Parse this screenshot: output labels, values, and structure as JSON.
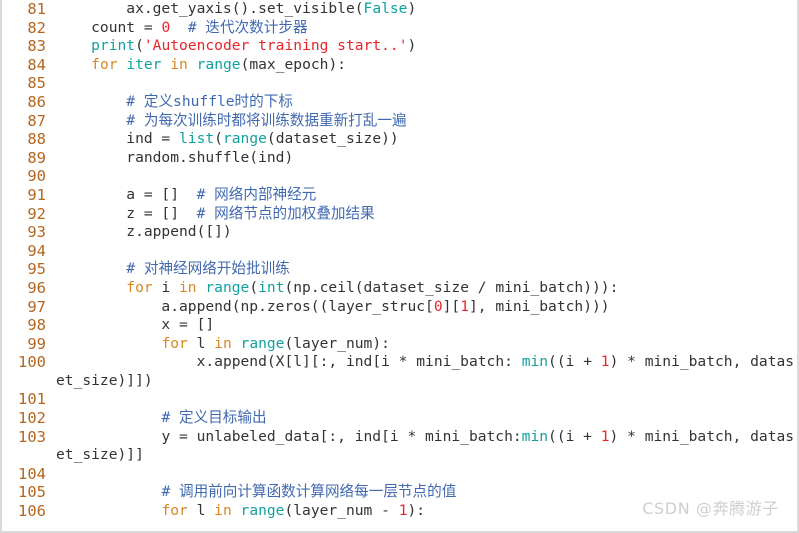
{
  "editor": {
    "language": "python",
    "first_line_number": 81,
    "last_line_number": 106,
    "colors": {
      "background": "#ffffff",
      "line_number": "#b4661e",
      "plain_text": "#333333",
      "keyword": "#d98723",
      "builtin": "#11a0a0",
      "string": "#e8242a",
      "number": "#e8242a",
      "comment": "#4169b0",
      "border": "#d9d9d9",
      "watermark": "#cfcfcf"
    }
  },
  "watermark": {
    "text": "CSDN @奔腾游子"
  },
  "lines": [
    {
      "number": "81",
      "wrapped": false,
      "tokens": [
        {
          "text": "        ax.get_yaxis().set_visible(",
          "type": "plain"
        },
        {
          "text": "False",
          "type": "builtin"
        },
        {
          "text": ")",
          "type": "plain"
        }
      ]
    },
    {
      "number": "82",
      "wrapped": false,
      "tokens": [
        {
          "text": "    count = ",
          "type": "plain"
        },
        {
          "text": "0",
          "type": "number"
        },
        {
          "text": "  ",
          "type": "plain"
        },
        {
          "text": "# 迭代次数计步器",
          "type": "comment"
        }
      ]
    },
    {
      "number": "83",
      "wrapped": false,
      "tokens": [
        {
          "text": "    ",
          "type": "plain"
        },
        {
          "text": "print",
          "type": "builtin"
        },
        {
          "text": "(",
          "type": "plain"
        },
        {
          "text": "'Autoencoder training start..'",
          "type": "string"
        },
        {
          "text": ")",
          "type": "plain"
        }
      ]
    },
    {
      "number": "84",
      "wrapped": false,
      "tokens": [
        {
          "text": "    ",
          "type": "plain"
        },
        {
          "text": "for",
          "type": "keyword"
        },
        {
          "text": " ",
          "type": "plain"
        },
        {
          "text": "iter",
          "type": "builtin"
        },
        {
          "text": " ",
          "type": "plain"
        },
        {
          "text": "in",
          "type": "keyword"
        },
        {
          "text": " ",
          "type": "plain"
        },
        {
          "text": "range",
          "type": "builtin"
        },
        {
          "text": "(max_epoch):",
          "type": "plain"
        }
      ]
    },
    {
      "number": "85",
      "wrapped": false,
      "tokens": [
        {
          "text": "",
          "type": "plain"
        }
      ]
    },
    {
      "number": "86",
      "wrapped": false,
      "tokens": [
        {
          "text": "        ",
          "type": "plain"
        },
        {
          "text": "# 定义shuffle时的下标",
          "type": "comment"
        }
      ]
    },
    {
      "number": "87",
      "wrapped": false,
      "tokens": [
        {
          "text": "        ",
          "type": "plain"
        },
        {
          "text": "# 为每次训练时都将训练数据重新打乱一遍",
          "type": "comment"
        }
      ]
    },
    {
      "number": "88",
      "wrapped": false,
      "tokens": [
        {
          "text": "        ind = ",
          "type": "plain"
        },
        {
          "text": "list",
          "type": "builtin"
        },
        {
          "text": "(",
          "type": "plain"
        },
        {
          "text": "range",
          "type": "builtin"
        },
        {
          "text": "(dataset_size))",
          "type": "plain"
        }
      ]
    },
    {
      "number": "89",
      "wrapped": false,
      "tokens": [
        {
          "text": "        random.shuffle(ind)",
          "type": "plain"
        }
      ]
    },
    {
      "number": "90",
      "wrapped": false,
      "tokens": [
        {
          "text": "",
          "type": "plain"
        }
      ]
    },
    {
      "number": "91",
      "wrapped": false,
      "tokens": [
        {
          "text": "        a = []  ",
          "type": "plain"
        },
        {
          "text": "# 网络内部神经元",
          "type": "comment"
        }
      ]
    },
    {
      "number": "92",
      "wrapped": false,
      "tokens": [
        {
          "text": "        z = []  ",
          "type": "plain"
        },
        {
          "text": "# 网络节点的加权叠加结果",
          "type": "comment"
        }
      ]
    },
    {
      "number": "93",
      "wrapped": false,
      "tokens": [
        {
          "text": "        z.append([])",
          "type": "plain"
        }
      ]
    },
    {
      "number": "94",
      "wrapped": false,
      "tokens": [
        {
          "text": "",
          "type": "plain"
        }
      ]
    },
    {
      "number": "95",
      "wrapped": false,
      "tokens": [
        {
          "text": "        ",
          "type": "plain"
        },
        {
          "text": "# 对神经网络开始批训练",
          "type": "comment"
        }
      ]
    },
    {
      "number": "96",
      "wrapped": false,
      "tokens": [
        {
          "text": "        ",
          "type": "plain"
        },
        {
          "text": "for",
          "type": "keyword"
        },
        {
          "text": " i ",
          "type": "plain"
        },
        {
          "text": "in",
          "type": "keyword"
        },
        {
          "text": " ",
          "type": "plain"
        },
        {
          "text": "range",
          "type": "builtin"
        },
        {
          "text": "(",
          "type": "plain"
        },
        {
          "text": "int",
          "type": "builtin"
        },
        {
          "text": "(np.ceil(dataset_size / mini_batch))):",
          "type": "plain"
        }
      ]
    },
    {
      "number": "97",
      "wrapped": false,
      "tokens": [
        {
          "text": "            a.append(np.zeros((layer_struc[",
          "type": "plain"
        },
        {
          "text": "0",
          "type": "number"
        },
        {
          "text": "][",
          "type": "plain"
        },
        {
          "text": "1",
          "type": "number"
        },
        {
          "text": "], mini_batch)))",
          "type": "plain"
        }
      ]
    },
    {
      "number": "98",
      "wrapped": false,
      "tokens": [
        {
          "text": "            x = []",
          "type": "plain"
        }
      ]
    },
    {
      "number": "99",
      "wrapped": false,
      "tokens": [
        {
          "text": "            ",
          "type": "plain"
        },
        {
          "text": "for",
          "type": "keyword"
        },
        {
          "text": " l ",
          "type": "plain"
        },
        {
          "text": "in",
          "type": "keyword"
        },
        {
          "text": " ",
          "type": "plain"
        },
        {
          "text": "range",
          "type": "builtin"
        },
        {
          "text": "(layer_num):",
          "type": "plain"
        }
      ]
    },
    {
      "number": "100",
      "wrapped": true,
      "tokens": [
        {
          "text": "                x.append(X[l][:, ind[i * mini_batch: ",
          "type": "plain"
        },
        {
          "text": "min",
          "type": "builtin"
        },
        {
          "text": "((i + ",
          "type": "plain"
        },
        {
          "text": "1",
          "type": "number"
        },
        {
          "text": ") * mini_batch, dataset_size)]])",
          "type": "plain"
        }
      ]
    },
    {
      "number": "101",
      "wrapped": false,
      "tokens": [
        {
          "text": "",
          "type": "plain"
        }
      ]
    },
    {
      "number": "102",
      "wrapped": false,
      "tokens": [
        {
          "text": "            ",
          "type": "plain"
        },
        {
          "text": "# 定义目标输出",
          "type": "comment"
        }
      ]
    },
    {
      "number": "103",
      "wrapped": true,
      "tokens": [
        {
          "text": "            y = unlabeled_data[:, ind[i * mini_batch:",
          "type": "plain"
        },
        {
          "text": "min",
          "type": "builtin"
        },
        {
          "text": "((i + ",
          "type": "plain"
        },
        {
          "text": "1",
          "type": "number"
        },
        {
          "text": ") * mini_batch, dataset_size)]]",
          "type": "plain"
        }
      ]
    },
    {
      "number": "104",
      "wrapped": false,
      "tokens": [
        {
          "text": "",
          "type": "plain"
        }
      ]
    },
    {
      "number": "105",
      "wrapped": false,
      "tokens": [
        {
          "text": "            ",
          "type": "plain"
        },
        {
          "text": "# 调用前向计算函数计算网络每一层节点的值",
          "type": "comment"
        }
      ]
    },
    {
      "number": "106",
      "wrapped": false,
      "tokens": [
        {
          "text": "            ",
          "type": "plain"
        },
        {
          "text": "for",
          "type": "keyword"
        },
        {
          "text": " l ",
          "type": "plain"
        },
        {
          "text": "in",
          "type": "keyword"
        },
        {
          "text": " ",
          "type": "plain"
        },
        {
          "text": "range",
          "type": "builtin"
        },
        {
          "text": "(layer_num - ",
          "type": "plain"
        },
        {
          "text": "1",
          "type": "number"
        },
        {
          "text": "):",
          "type": "plain"
        }
      ]
    }
  ]
}
